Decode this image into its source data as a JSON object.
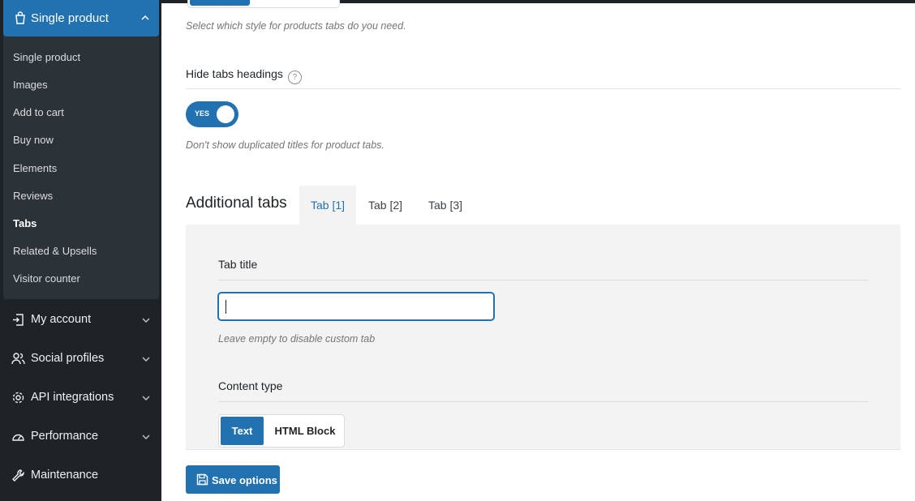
{
  "sidebar": {
    "active_section": {
      "label": "Single product",
      "icon": "shopping-bag-icon",
      "chevron": "chevron-up-icon"
    },
    "subitems": [
      {
        "label": "Single product"
      },
      {
        "label": "Images"
      },
      {
        "label": "Add to cart"
      },
      {
        "label": "Buy now"
      },
      {
        "label": "Elements"
      },
      {
        "label": "Reviews"
      },
      {
        "label": "Tabs",
        "active": true
      },
      {
        "label": "Related & Upsells"
      },
      {
        "label": "Visitor counter"
      }
    ],
    "items": [
      {
        "label": "My account",
        "icon": "login-icon"
      },
      {
        "label": "Social profiles",
        "icon": "users-icon"
      },
      {
        "label": "API integrations",
        "icon": "gear-icon"
      },
      {
        "label": "Performance",
        "icon": "gauge-icon"
      },
      {
        "label": "Maintenance",
        "icon": "wrench-icon"
      }
    ]
  },
  "main": {
    "tabs_style_desc": "Select which style for products tabs do you need.",
    "hide_headings": {
      "label": "Hide tabs headings",
      "help": "?",
      "toggle_text": "YES",
      "toggle_on": true,
      "desc": "Don't show duplicated titles for product tabs."
    },
    "additional_tabs": {
      "title": "Additional tabs",
      "tabs": [
        "Tab [1]",
        "Tab [2]",
        "Tab [3]"
      ],
      "active_tab": 0
    },
    "tab_title": {
      "label": "Tab title",
      "value": "",
      "desc": "Leave empty to disable custom tab"
    },
    "content_type": {
      "label": "Content type",
      "options": [
        "Text",
        "HTML Block"
      ],
      "selected": "Text"
    },
    "save_label": "Save options"
  },
  "colors": {
    "accent": "#2271b1",
    "sidebar_bg": "#1d2327",
    "panel_bg": "#f3f3f3"
  }
}
